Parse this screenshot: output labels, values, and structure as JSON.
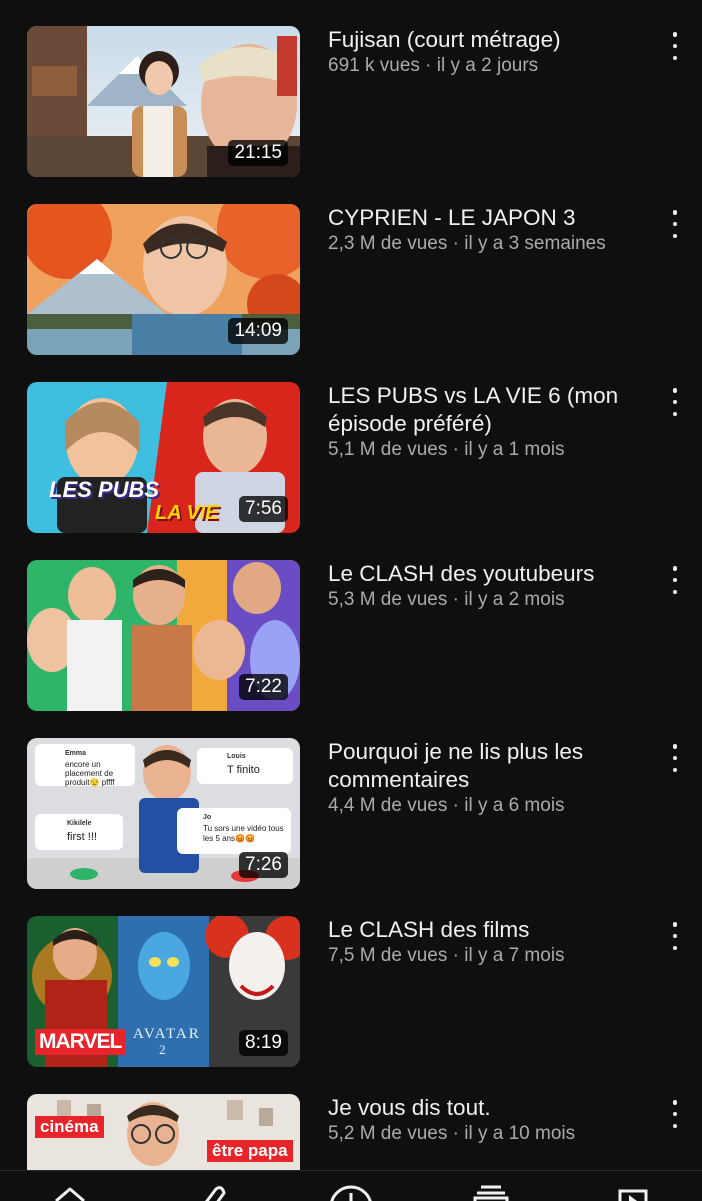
{
  "videos": [
    {
      "title": "Fujisan (court métrage)",
      "meta": "691 k vues · il y a 2 jours",
      "duration": "21:15"
    },
    {
      "title": "CYPRIEN - LE JAPON 3",
      "meta": "2,3 M de vues · il y a 3 semaines",
      "duration": "14:09"
    },
    {
      "title": "LES PUBS vs LA VIE 6 (mon épisode préféré)",
      "meta": "5,1 M de vues · il y a 1 mois",
      "duration": "7:56"
    },
    {
      "title": "Le CLASH des youtubeurs",
      "meta": "5,3 M de vues · il y a 2 mois",
      "duration": "7:22"
    },
    {
      "title": "Pourquoi je ne lis plus les commentaires",
      "meta": "4,4 M de vues · il y a 6 mois",
      "duration": "7:26"
    },
    {
      "title": "Le CLASH des films",
      "meta": "7,5 M de vues · il y a 7 mois",
      "duration": "8:19"
    },
    {
      "title": "Je vous dis tout.",
      "meta": "5,2 M de vues · il y a 10 mois",
      "duration": ""
    }
  ],
  "thumb_text": {
    "les_pubs": "LES PUBS",
    "la_vie": "LA VIE",
    "marvel": "MARVEL",
    "avatar": "AVATAR",
    "avatar_num": "2",
    "cinema": "cinéma",
    "etre_papa": "être papa",
    "comment1_user": "Emma",
    "comment1_text": "encore un placement de produit😒 pffff",
    "comment2_user": "Louis",
    "comment2_text": "T finito",
    "comment3_user": "Kikilele",
    "comment3_text": "first !!!",
    "comment4_user": "Jo",
    "comment4_text": "Tu sors une vidéo tous les 5 ans😡😡"
  },
  "nav": {
    "icons": [
      "home-icon",
      "shorts-icon",
      "create-icon",
      "subscriptions-icon",
      "library-icon"
    ]
  },
  "colors": {
    "background": "#0f0f0f",
    "title": "#f1f1f1",
    "meta": "#aaaaaa"
  }
}
